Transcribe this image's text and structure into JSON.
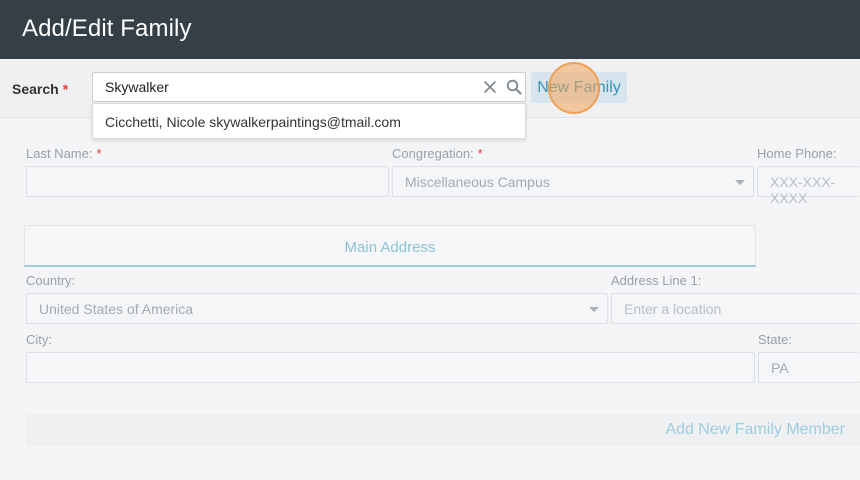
{
  "header": {
    "title": "Add/Edit Family"
  },
  "search": {
    "label": "Search",
    "required_mark": "*",
    "value": "Skywalker",
    "new_family_label": "New Family",
    "results": [
      "Cicchetti, Nicole skywalkerpaintings@tmail.com"
    ]
  },
  "form": {
    "last_name": {
      "label": "Last Name:",
      "required_mark": "*",
      "value": ""
    },
    "congregation": {
      "label": "Congregation:",
      "required_mark": "*",
      "value": "Miscellaneous Campus"
    },
    "home_phone": {
      "label": "Home Phone:",
      "placeholder": "XXX-XXX-XXXX"
    },
    "main_address": {
      "title": "Main Address",
      "country": {
        "label": "Country:",
        "value": "United States of America"
      },
      "address_line1": {
        "label": "Address Line 1:",
        "placeholder": "Enter a location"
      },
      "city": {
        "label": "City:",
        "value": ""
      },
      "state": {
        "label": "State:",
        "value": "PA"
      }
    },
    "add_member_label": "Add New Family Member"
  },
  "colors": {
    "header_bg": "#353f47",
    "accent": "#3a93b3",
    "required": "#e53935",
    "click_indicator": "#f5a65a"
  }
}
